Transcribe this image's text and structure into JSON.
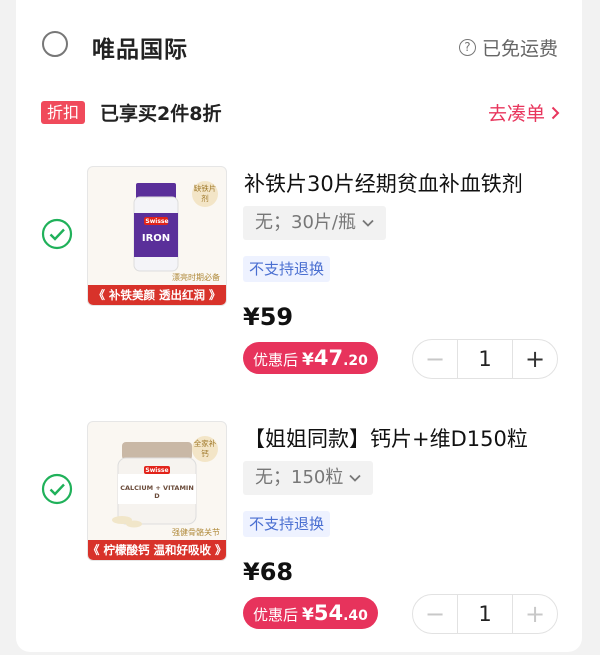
{
  "store": {
    "name": "唯品国际",
    "shipping_label": "已免运费",
    "help_icon": "question-circle-icon"
  },
  "promo": {
    "tag": "折扣",
    "text": "已享买2件8折",
    "link": "去凑单",
    "link_color": "#e8365d"
  },
  "items": [
    {
      "checked": true,
      "title": "补铁片30片经期贫血补血铁剂",
      "spec": "无；30片/瓶",
      "no_return": "不支持退换",
      "price": "¥59",
      "after_label": "优惠后",
      "after_yen": "¥",
      "after_int": "47",
      "after_dec": ".20",
      "quantity": "1",
      "thumb": {
        "brand": "Swisse",
        "product": "IRON",
        "badge": "缺铁片剂",
        "note": "漂亮时期必备",
        "banner": "《 补铁美颜 透出红润 》"
      }
    },
    {
      "checked": true,
      "title": "【姐姐同款】钙片+维D150粒",
      "spec": "无；150粒",
      "no_return": "不支持退换",
      "price": "¥68",
      "after_label": "优惠后",
      "after_yen": "¥",
      "after_int": "54",
      "after_dec": ".40",
      "quantity": "1",
      "thumb": {
        "brand": "Swisse",
        "product": "CALCIUM + VITAMIN D",
        "badge": "全家补钙",
        "note": "强健骨骼关节",
        "banner": "《 柠檬酸钙 温和好吸收 》"
      }
    }
  ],
  "colors": {
    "accent": "#e7335c",
    "check": "#20b15a",
    "promo_tag": "#f04a5b",
    "no_return_text": "#4a6fd1"
  }
}
